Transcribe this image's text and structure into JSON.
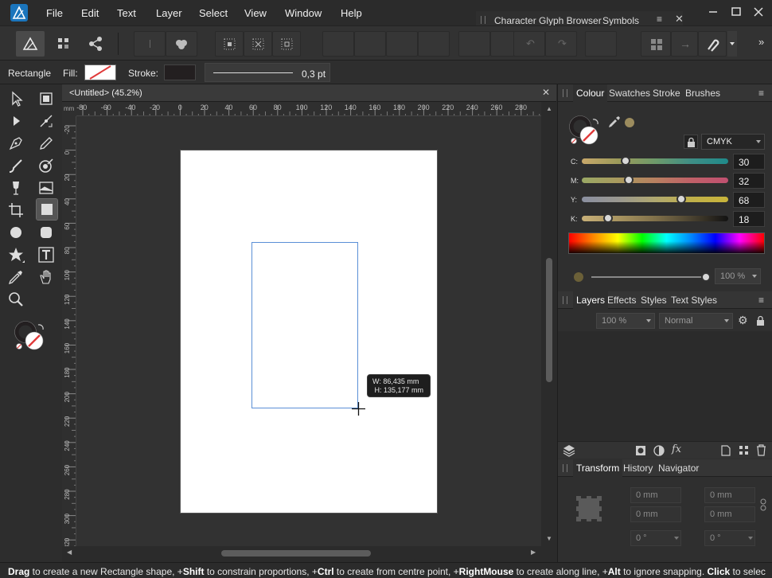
{
  "menu": {
    "items": [
      "File",
      "Edit",
      "Text",
      "Layer",
      "Select",
      "View",
      "Window",
      "Help"
    ]
  },
  "top_studio_tabs": [
    "Character",
    "Glyph Browser",
    "Symbols"
  ],
  "context": {
    "tool_name": "Rectangle",
    "fill_label": "Fill:",
    "stroke_label": "Stroke:",
    "stroke_width": "0,3 pt"
  },
  "document": {
    "tab_title": "<Untitled> (45.2%)",
    "ruler_unit": "mm",
    "h_ruler_labels": [
      "-80",
      "-60",
      "-40",
      "-20",
      "0",
      "20",
      "40",
      "60",
      "80",
      "100",
      "120",
      "140",
      "160",
      "180",
      "200",
      "220",
      "240",
      "260",
      "280"
    ],
    "v_ruler_labels": [
      "-20",
      "0",
      "20",
      "40",
      "60",
      "80",
      "100",
      "120",
      "140",
      "160",
      "180",
      "200",
      "220",
      "240",
      "260",
      "280",
      "300",
      "320"
    ],
    "size_tooltip": {
      "width": "W: 86,435 mm",
      "height": "H: 135,177 mm"
    }
  },
  "colour_panel": {
    "tabs": [
      "Colour",
      "Swatches",
      "Stroke",
      "Brushes"
    ],
    "mode": "CMYK",
    "channels": [
      {
        "label": "C:",
        "value": "30",
        "level": 30
      },
      {
        "label": "M:",
        "value": "32",
        "level": 32
      },
      {
        "label": "Y:",
        "value": "68",
        "level": 68
      },
      {
        "label": "K:",
        "value": "18",
        "level": 18
      }
    ],
    "opacity": "100 %"
  },
  "layers_panel": {
    "tabs": [
      "Layers",
      "Effects",
      "Styles",
      "Text Styles"
    ],
    "opacity": "100 %",
    "blend_mode": "Normal"
  },
  "transform_panel": {
    "tabs": [
      "Transform",
      "History",
      "Navigator"
    ],
    "x": "0 mm",
    "y": "0 mm",
    "w": "0 mm",
    "h": "0 mm",
    "rotation": "0 °",
    "shear": "0 °"
  },
  "status": {
    "parts": [
      {
        "b": "Drag",
        "t": " to create a new Rectangle shape, +"
      },
      {
        "b": "Shift",
        "t": " to constrain proportions, +"
      },
      {
        "b": "Ctrl",
        "t": " to create from centre point, +"
      },
      {
        "b": "RightMouse",
        "t": " to create along line, +"
      },
      {
        "b": "Alt",
        "t": " to ignore snapping. "
      },
      {
        "b": "Click",
        "t": " to selec"
      }
    ]
  },
  "colors": {
    "accent_blue": "#5a8fd6",
    "panel_bg": "#2f2f2f",
    "swatch_olive": "#9c8c5e"
  },
  "icons": [
    "affinity-logo-icon",
    "minimize-icon",
    "maximize-icon",
    "close-icon",
    "persona-designer-icon",
    "persona-pixel-icon",
    "persona-export-icon",
    "select-tool-icon",
    "artboard-tool-icon",
    "node-tool-icon",
    "corner-tool-icon",
    "pen-tool-icon",
    "pencil-tool-icon",
    "brush-tool-icon",
    "fill-tool-icon",
    "transparency-tool-icon",
    "place-image-icon",
    "crop-tool-icon",
    "rectangle-tool-icon",
    "ellipse-tool-icon",
    "rounded-rect-tool-icon",
    "star-tool-icon",
    "text-tool-icon",
    "eyedropper-tool-icon",
    "hand-tool-icon",
    "zoom-tool-icon",
    "lock-icon",
    "gear-icon",
    "layers-icon",
    "mask-icon",
    "fx-icon",
    "trash-icon"
  ]
}
